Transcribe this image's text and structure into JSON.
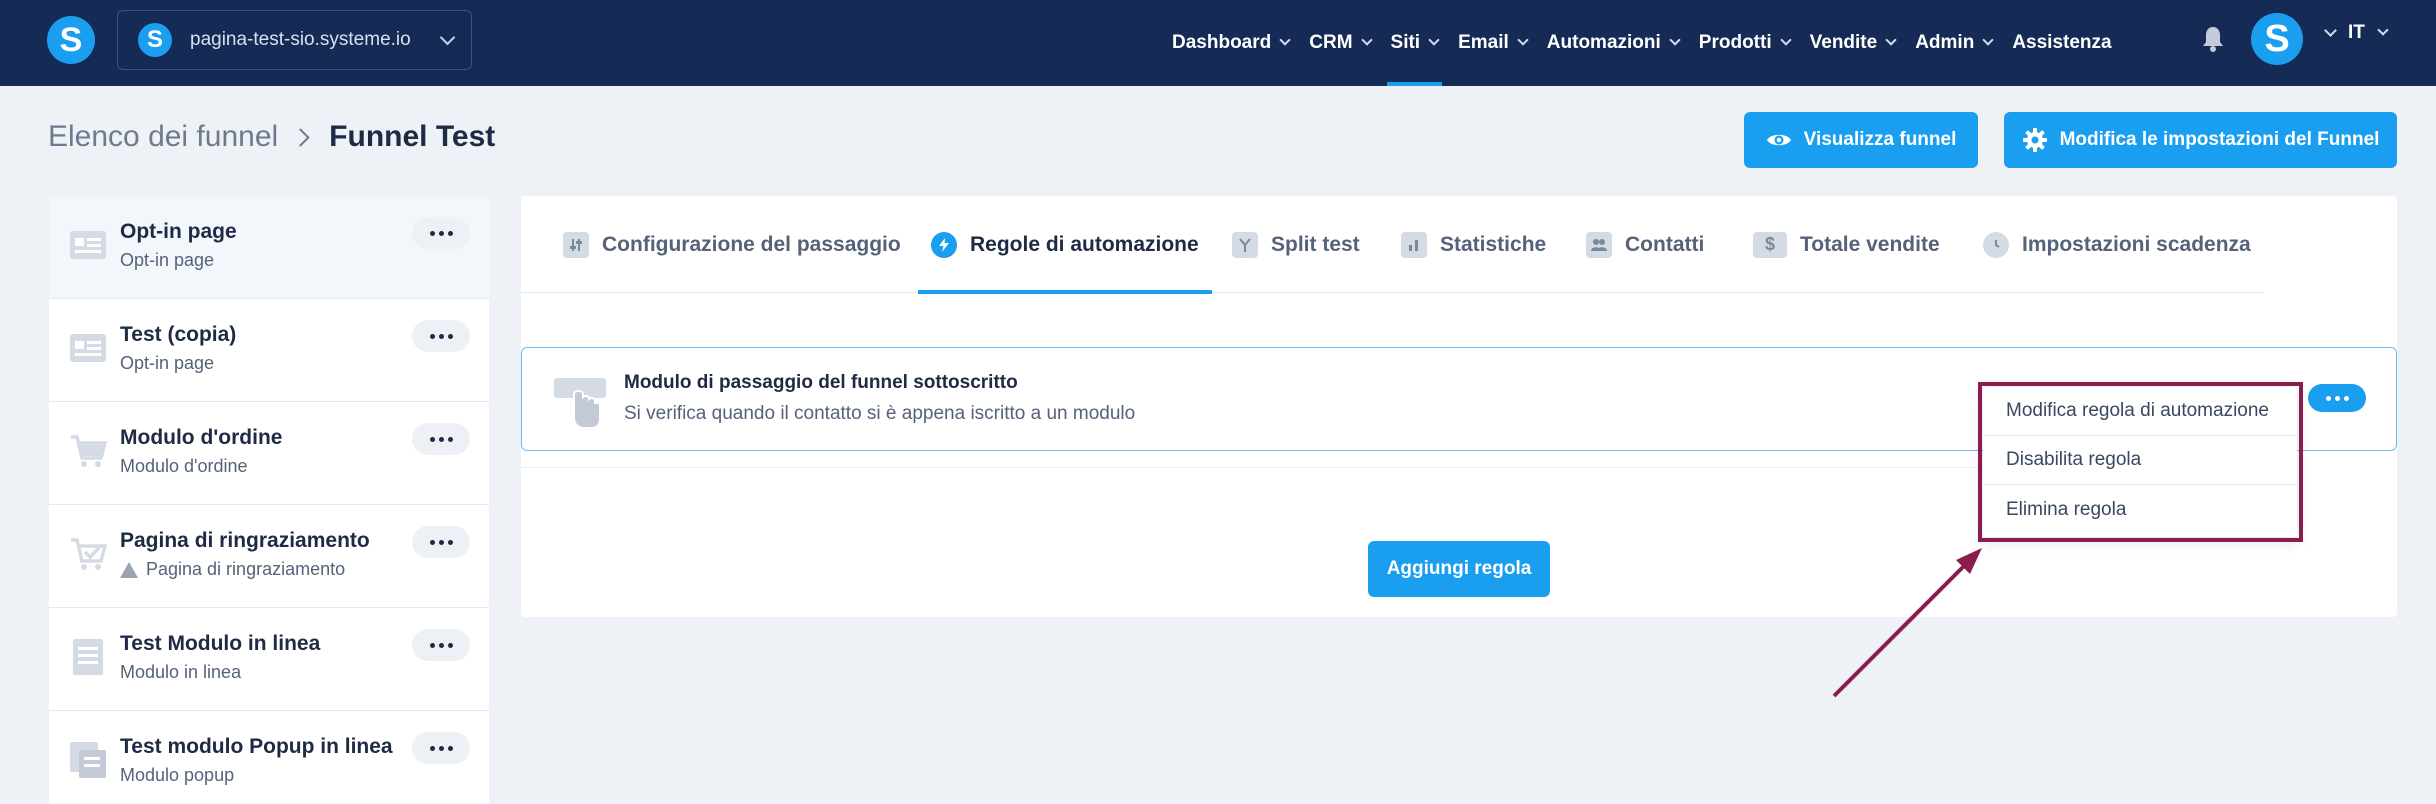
{
  "topbar": {
    "logo_letter": "S",
    "site_letter": "S",
    "site_name": "pagina-test-sio.systeme.io",
    "nav": [
      {
        "label": "Dashboard",
        "active": false
      },
      {
        "label": "CRM",
        "active": false
      },
      {
        "label": "Siti",
        "active": true
      },
      {
        "label": "Email",
        "active": false
      },
      {
        "label": "Automazioni",
        "active": false
      },
      {
        "label": "Prodotti",
        "active": false
      },
      {
        "label": "Vendite",
        "active": false
      },
      {
        "label": "Admin",
        "active": false
      },
      {
        "label": "Assistenza",
        "active": false
      }
    ],
    "avatar_letter": "S",
    "language": "IT"
  },
  "breadcrumb": {
    "root": "Elenco dei funnel",
    "current": "Funnel Test"
  },
  "actions": {
    "view_funnel": "Visualizza funnel",
    "edit_settings": "Modifica le impostazioni del Funnel"
  },
  "sidebar": {
    "items": [
      {
        "title": "Opt-in page",
        "subtitle": "Opt-in page",
        "icon": "optin-page-icon",
        "warning": false
      },
      {
        "title": "Test (copia)",
        "subtitle": "Opt-in page",
        "icon": "optin-page-icon",
        "warning": false
      },
      {
        "title": "Modulo d'ordine",
        "subtitle": "Modulo d'ordine",
        "icon": "cart-icon",
        "warning": false
      },
      {
        "title": "Pagina di ringraziamento",
        "subtitle": "Pagina di ringraziamento",
        "icon": "cart-check-icon",
        "warning": true
      },
      {
        "title": "Test Modulo in linea",
        "subtitle": "Modulo in linea",
        "icon": "document-icon",
        "warning": false
      },
      {
        "title": "Test modulo Popup in linea",
        "subtitle": "Modulo popup",
        "icon": "popup-icon",
        "warning": false
      }
    ]
  },
  "tabs": [
    {
      "label": "Configurazione del passaggio",
      "icon": "sliders-icon",
      "active": false
    },
    {
      "label": "Regole di automazione",
      "icon": "bolt-icon",
      "active": true
    },
    {
      "label": "Split test",
      "icon": "split-icon",
      "active": false
    },
    {
      "label": "Statistiche",
      "icon": "chart-icon",
      "active": false
    },
    {
      "label": "Contatti",
      "icon": "users-icon",
      "active": false
    },
    {
      "label": "Totale vendite",
      "icon": "dollar-icon",
      "active": false
    },
    {
      "label": "Impostazioni scadenza",
      "icon": "clock-icon",
      "active": false
    }
  ],
  "rule": {
    "title": "Modulo di passaggio del funnel sottoscritto",
    "description": "Si verifica quando il contatto si è appena iscritto a un modulo"
  },
  "dropdown": {
    "items": [
      "Modifica regola di automazione",
      "Disabilita regola",
      "Elimina regola"
    ]
  },
  "add_rule": "Aggiungi regola",
  "colors": {
    "navbar": "#152a55",
    "accent": "#1a9ef0",
    "annotation": "#8c1c4f",
    "background": "#eef2f7"
  }
}
